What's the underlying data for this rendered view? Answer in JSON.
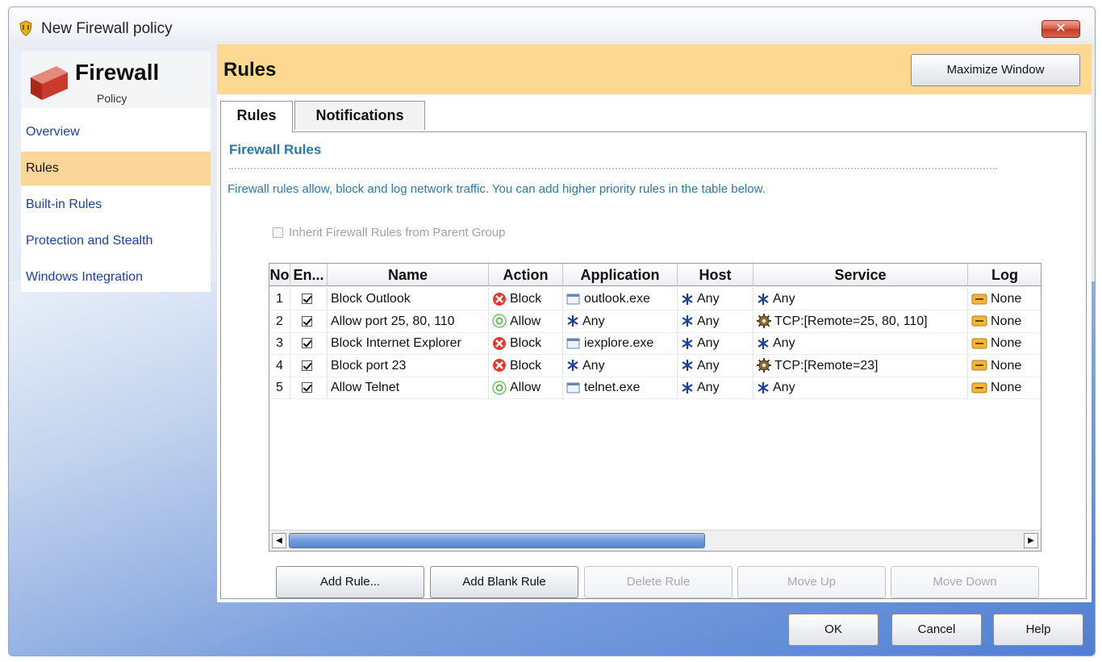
{
  "window": {
    "title": "New Firewall policy",
    "close_label": "✕"
  },
  "nav": {
    "title": "Firewall",
    "subtitle": "Policy",
    "items": [
      {
        "label": "Overview"
      },
      {
        "label": "Rules",
        "selected": true
      },
      {
        "label": "Built-in Rules"
      },
      {
        "label": "Protection and Stealth"
      },
      {
        "label": "Windows Integration"
      }
    ]
  },
  "content": {
    "title": "Rules",
    "maximize_label": "Maximize Window",
    "tabs": [
      {
        "label": "Rules",
        "active": true
      },
      {
        "label": "Notifications"
      }
    ],
    "section_title": "Firewall Rules",
    "description": "Firewall rules allow, block and log network traffic. You can add higher priority rules in the table below.",
    "inherit_label": "Inherit Firewall Rules from Parent Group"
  },
  "table": {
    "columns": [
      "No",
      "En...",
      "Name",
      "Action",
      "Application",
      "Host",
      "Service",
      "Log"
    ],
    "rows": [
      {
        "no": "1",
        "name": "Block Outlook",
        "action": "Block",
        "app": "outlook.exe",
        "app_icon": "exe-icon",
        "host": "Any",
        "service": "Any",
        "service_icon": "any-icon",
        "log": "None"
      },
      {
        "no": "2",
        "name": "Allow port 25, 80, 110",
        "action": "Allow",
        "app": "Any",
        "app_icon": "any-icon",
        "host": "Any",
        "service": "TCP:[Remote=25, 80, 110]",
        "service_icon": "gear-icon",
        "log": "None"
      },
      {
        "no": "3",
        "name": "Block Internet Explorer",
        "action": "Block",
        "app": "iexplore.exe",
        "app_icon": "exe-icon",
        "host": "Any",
        "service": "Any",
        "service_icon": "any-icon",
        "log": "None"
      },
      {
        "no": "4",
        "name": "Block port 23",
        "action": "Block",
        "app": "Any",
        "app_icon": "any-icon",
        "host": "Any",
        "service": "TCP:[Remote=23]",
        "service_icon": "gear-icon",
        "log": "None"
      },
      {
        "no": "5",
        "name": "Allow Telnet",
        "action": "Allow",
        "app": "telnet.exe",
        "app_icon": "exe-icon",
        "host": "Any",
        "service": "Any",
        "service_icon": "any-icon",
        "log": "None"
      }
    ]
  },
  "actions": {
    "add_rule": "Add Rule...",
    "add_blank_rule": "Add Blank Rule",
    "delete_rule": "Delete Rule",
    "move_up": "Move Up",
    "move_down": "Move Down"
  },
  "footer": {
    "ok": "OK",
    "cancel": "Cancel",
    "help": "Help"
  },
  "colors": {
    "header_bg": "#fdd890",
    "nav_selected": "#fad69b",
    "link": "#1a3fa8",
    "section": "#2a79a8"
  }
}
